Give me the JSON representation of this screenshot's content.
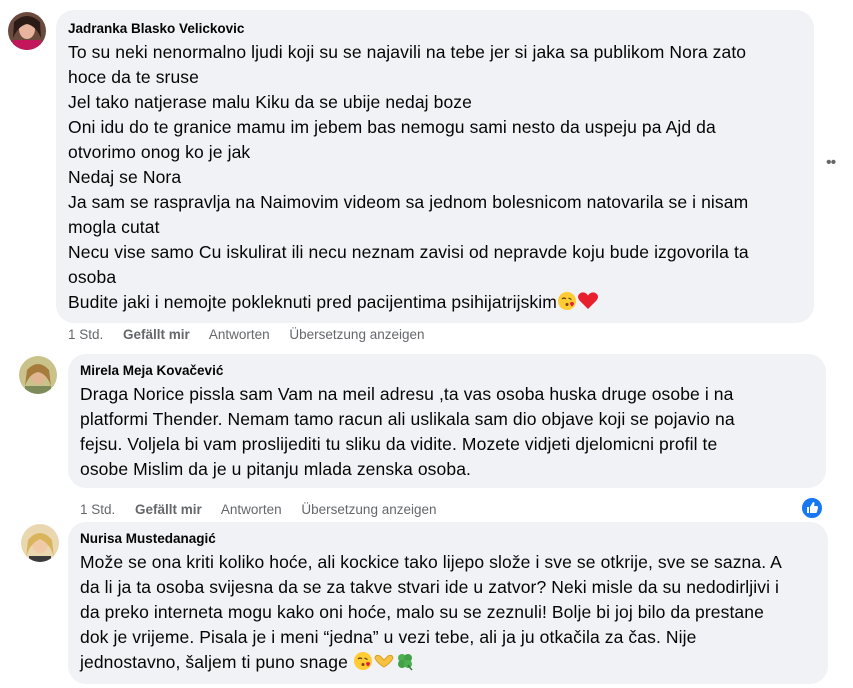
{
  "comments": [
    {
      "author": "Jadranka Blasko Velickovic",
      "lines": [
        "To su neki nenormalno ljudi koji su se najavili na tebe jer si jaka sa publikom Nora zato",
        "hoce da te sruse",
        "Jel tako natjerase malu Kiku da se ubije nedaj boze",
        "Oni idu do te granice mamu im jebem bas nemogu sami nesto da uspeju pa Ajd da",
        "otvorimo onog ko je jak",
        "Nedaj se Nora",
        "Ja sam se raspravlja na Naimovim videom sa jednom bolesnicom natovarila se i nisam",
        "mogla cutat",
        "Necu vise samo Cu iskulirat ili necu neznam zavisi od nepravde koju bude izgovorila ta",
        "osoba",
        "Budite jaki i nemojte pokleknuti pred pacijentima psihijatrijskim"
      ],
      "time": "1 Std.",
      "like": "Gefällt mir",
      "reply": "Antworten",
      "translate": "Übersetzung anzeigen"
    },
    {
      "author": "Mirela Meja Kovačević",
      "lines": [
        "Draga Norice pissla sam Vam na meil adresu ,ta vas osoba huska druge osobe i na",
        "platformi Thender. Nemam tamo racun ali uslikala sam dio objave koji se pojavio na",
        "fejsu. Voljela bi vam proslijediti tu sliku da vidite. Mozete vidjeti djelomicni profil te",
        "osobe Mislim da je u pitanju mlada zenska osoba."
      ],
      "time": "1 Std.",
      "like": "Gefällt mir",
      "reply": "Antworten",
      "translate": "Übersetzung anzeigen"
    },
    {
      "author": "Nurisa Mustedanagić",
      "lines": [
        "Može se ona kriti koliko hoće, ali kockice tako lijepo slože i sve se otkrije, sve se sazna. A",
        "da li ja ta osoba svijesna da se za takve stvari ide u zatvor? Neki misle da su nedodirljivi i",
        "da preko interneta mogu kako oni hoće, malo su se zeznuli! Bolje bi joj bilo da prestane",
        "dok je vrijeme. Pisala je i meni “jedna” u vezi tebe, ali ja ju otkačila za čas. Nije",
        "jednostavno, šaljem ti puno snage"
      ]
    }
  ],
  "colors": {
    "bubble": "#f0f2f5",
    "secondary_text": "#65676b",
    "like_blue": "#1877f2"
  },
  "icons": [
    "more-options-icon",
    "like-reaction-icon",
    "kissing-face-icon",
    "heart-icon",
    "heart-hands-icon",
    "four-leaf-clover-icon"
  ]
}
